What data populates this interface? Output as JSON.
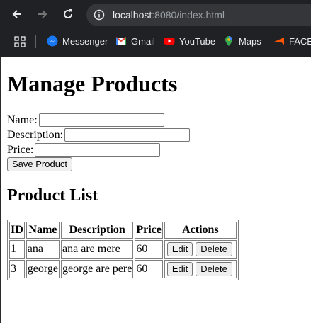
{
  "browser": {
    "url_host": "localhost",
    "url_path": ":8080/index.html",
    "bookmarks": [
      {
        "label": "Messenger",
        "icon": "messenger-icon"
      },
      {
        "label": "Gmail",
        "icon": "gmail-icon"
      },
      {
        "label": "YouTube",
        "icon": "youtube-icon"
      },
      {
        "label": "Maps",
        "icon": "maps-icon"
      },
      {
        "label": "FACEIT",
        "icon": "faceit-icon"
      }
    ]
  },
  "page": {
    "title": "Manage Products",
    "form": {
      "name_label": "Name:",
      "name_value": "",
      "description_label": "Description:",
      "description_value": "",
      "price_label": "Price:",
      "price_value": "",
      "save_label": "Save Product"
    },
    "list_title": "Product List",
    "table": {
      "headers": [
        "ID",
        "Name",
        "Description",
        "Price",
        "Actions"
      ],
      "rows": [
        {
          "id": "1",
          "name": "ana",
          "description": "ana are mere",
          "price": "60",
          "edit": "Edit",
          "delete": "Delete"
        },
        {
          "id": "3",
          "name": "george",
          "description": "george are pere",
          "price": "60",
          "edit": "Edit",
          "delete": "Delete"
        }
      ]
    }
  },
  "colors": {
    "chrome_bg": "#202124",
    "urlbar_bg": "#35363a",
    "button_bg": "#efefef"
  }
}
